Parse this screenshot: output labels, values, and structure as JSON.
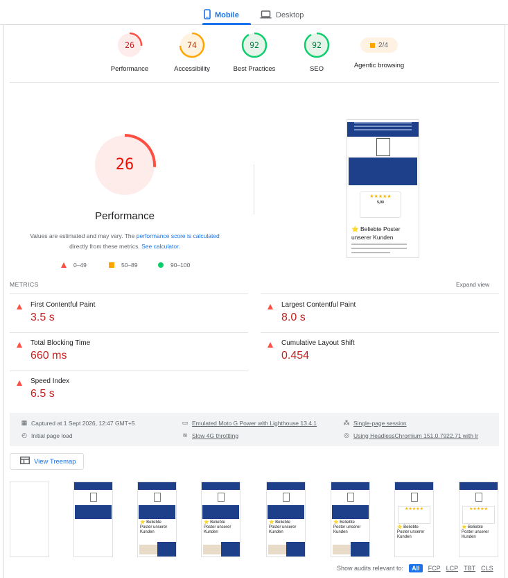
{
  "tabs": [
    {
      "label": "Mobile",
      "icon": "phone-icon",
      "active": true
    },
    {
      "label": "Desktop",
      "icon": "laptop-icon",
      "active": false
    }
  ],
  "categories": [
    {
      "label": "Performance",
      "score": "26",
      "value": 26,
      "color": "#ff4e42",
      "bg": "#fdecea",
      "text": "#c5221f"
    },
    {
      "label": "Accessibility",
      "score": "74",
      "value": 74,
      "color": "#ffa400",
      "bg": "#fff3e0",
      "text": "#c33300"
    },
    {
      "label": "Best Practices",
      "score": "92",
      "value": 92,
      "color": "#0cce6b",
      "bg": "#e6f4ea",
      "text": "#018642"
    },
    {
      "label": "SEO",
      "score": "92",
      "value": 92,
      "color": "#0cce6b",
      "bg": "#e6f4ea",
      "text": "#018642"
    },
    {
      "label": "Agentic browsing",
      "score": "2/4",
      "color": "#ffa400"
    }
  ],
  "performance": {
    "score": "26",
    "value": 26,
    "title": "Performance",
    "desc_1": "Values are estimated and may vary. The ",
    "desc_link_1": "performance score is calculated",
    "desc_2": "directly from these metrics. ",
    "desc_link_2": "See calculator.",
    "legend": [
      "0–49",
      "50–89",
      "90–100"
    ]
  },
  "screenshot": {
    "heading": "⭐ Beliebte Poster unserer Kunden",
    "rating": "5,00"
  },
  "metrics": {
    "title": "METRICS",
    "expand": "Expand view",
    "items": [
      {
        "name": "First Contentful Paint",
        "value": "3.5 s"
      },
      {
        "name": "Largest Contentful Paint",
        "value": "8.0 s"
      },
      {
        "name": "Total Blocking Time",
        "value": "660 ms"
      },
      {
        "name": "Cumulative Layout Shift",
        "value": "0.454"
      },
      {
        "name": "Speed Index",
        "value": "6.5 s"
      }
    ]
  },
  "info": {
    "captured": "Captured at 1 Sept 2026, 12:47 GMT+5",
    "load": "Initial page load",
    "device": "Emulated Moto G Power with Lighthouse 13.4.1",
    "throttle": "Slow 4G throttling",
    "session": "Single-page session",
    "browser": "Using HeadlessChromium 151.0.7922.71 with lr"
  },
  "treemap": "View Treemap",
  "filmstrip_heading": "⭐ Beliebte Poster unserer Kunden",
  "filter": {
    "label": "Show audits relevant to:",
    "chips": [
      "All",
      "FCP",
      "LCP",
      "TBT",
      "CLS"
    ]
  }
}
